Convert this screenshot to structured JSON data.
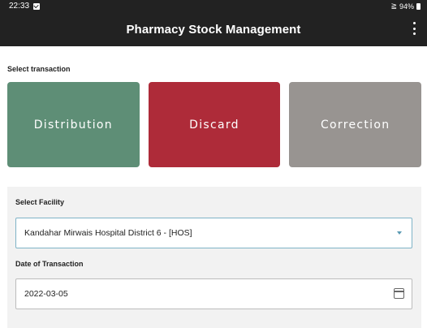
{
  "status_bar": {
    "time": "22:33",
    "battery": "94%"
  },
  "app_bar": {
    "title": "Pharmacy Stock Management"
  },
  "transactions": {
    "label": "Select transaction",
    "distribution": "Distribution",
    "discard": "Discard",
    "correction": "Correction"
  },
  "form": {
    "facility_label": "Select Facility",
    "facility_value": "Kandahar Mirwais Hospital District 6 -  [HOS]",
    "date_label": "Date of Transaction",
    "date_value": "2022-03-05"
  },
  "icons": {
    "notification": "checkbox-icon",
    "wifi": "wifi-icon",
    "battery": "battery-icon",
    "menu": "more-vert-icon",
    "dropdown": "dropdown-arrow-icon",
    "calendar": "calendar-icon"
  },
  "colors": {
    "app_bar": "#222222",
    "distribution": "#5e8e76",
    "discard": "#ae2b39",
    "correction": "#989491",
    "select_border": "#7fb3c7"
  }
}
